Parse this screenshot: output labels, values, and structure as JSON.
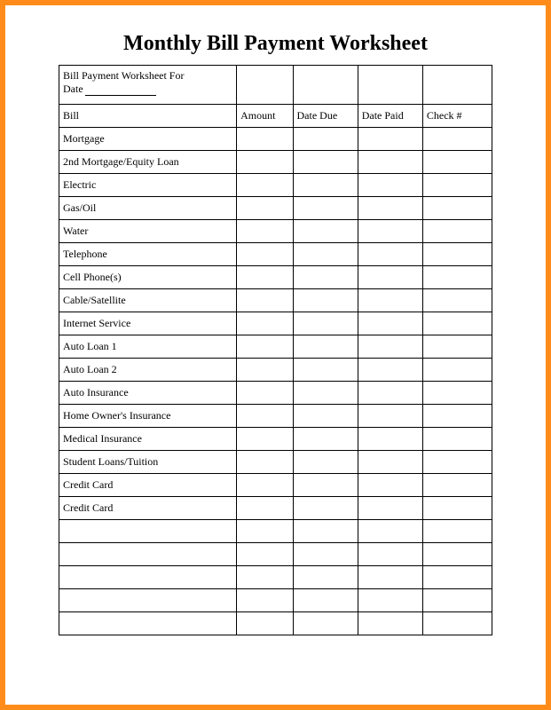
{
  "title": "Monthly Bill Payment Worksheet",
  "header": {
    "label_line1": "Bill Payment Worksheet For",
    "label_line2": "Date"
  },
  "columns": {
    "bill": "Bill",
    "amount": "Amount",
    "date_due": "Date Due",
    "date_paid": "Date Paid",
    "check_num": "Check #"
  },
  "rows": [
    "Mortgage",
    "2nd Mortgage/Equity Loan",
    "Electric",
    "Gas/Oil",
    "Water",
    "Telephone",
    "Cell Phone(s)",
    "Cable/Satellite",
    "Internet Service",
    "Auto Loan 1",
    "Auto Loan 2",
    "Auto Insurance",
    "Home Owner's Insurance",
    "Medical Insurance",
    "Student Loans/Tuition",
    "Credit Card",
    "Credit Card",
    "",
    "",
    "",
    "",
    ""
  ]
}
